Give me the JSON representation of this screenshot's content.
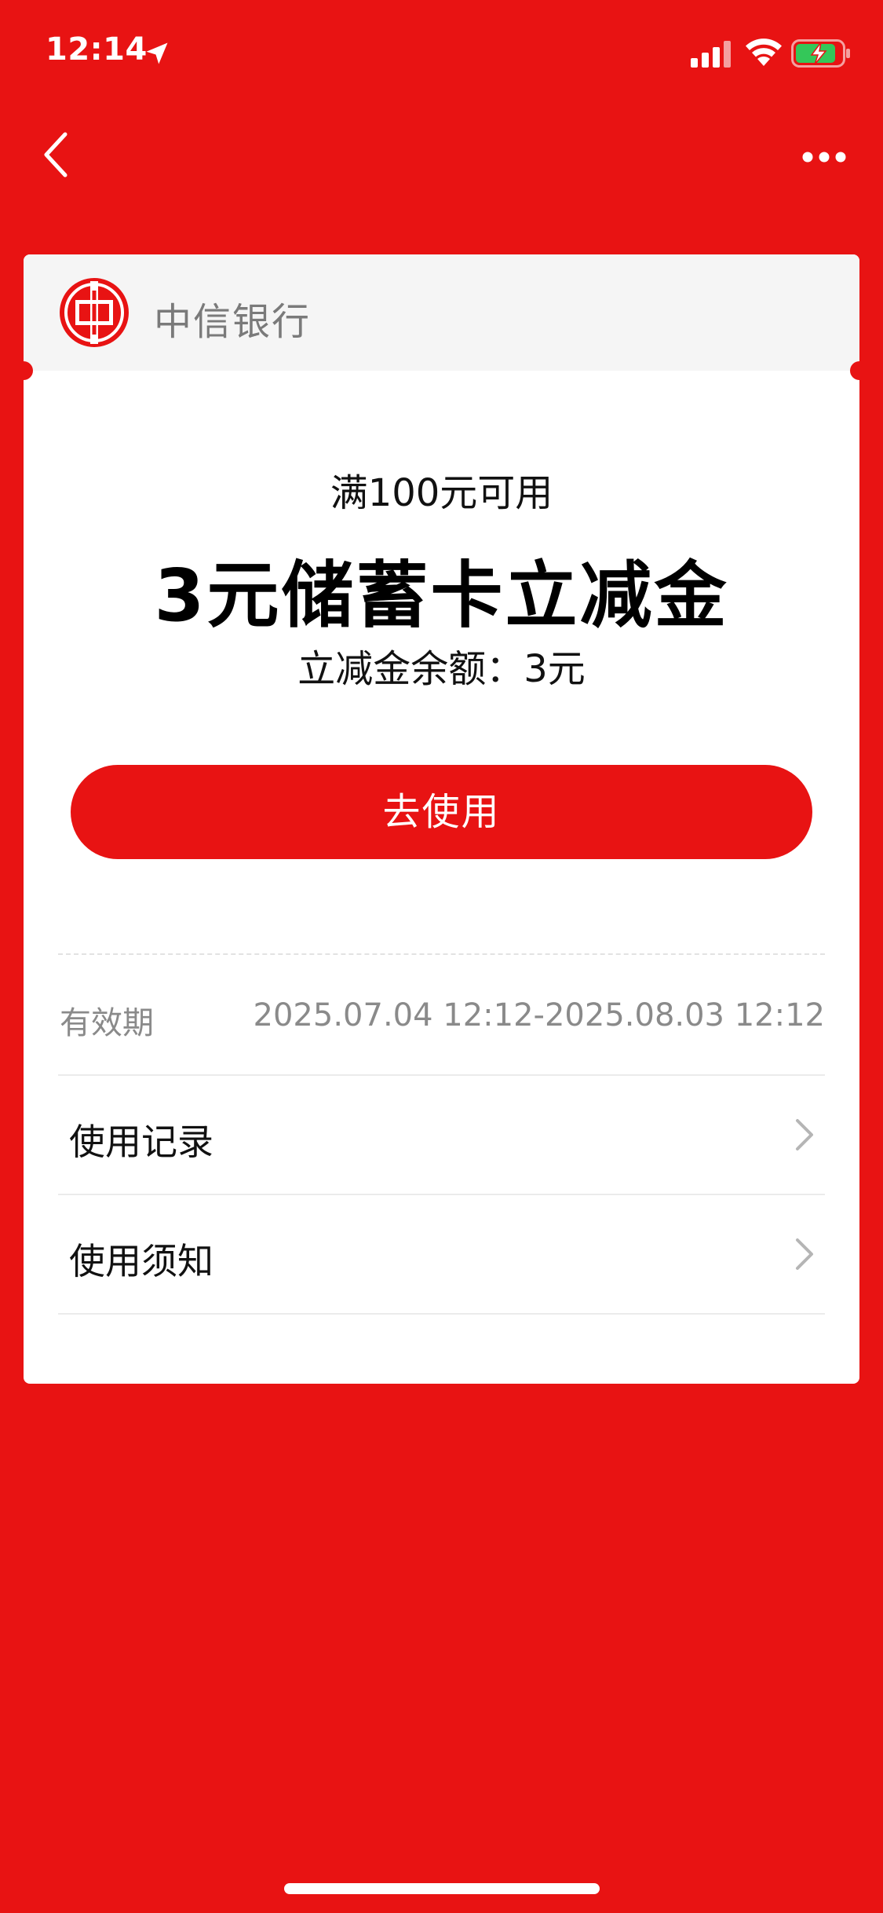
{
  "status_bar": {
    "time": "12:14"
  },
  "nav": {
    "back_icon": "chevron-left-icon",
    "more_icon": "more-horizontal-icon"
  },
  "card": {
    "bank_name": "中信银行",
    "condition": "满100元可用",
    "title": "3元储蓄卡立减金",
    "balance": "立减金余额：3元",
    "use_button_label": "去使用",
    "validity_label": "有效期",
    "validity_value": "2025.07.04 12:12-2025.08.03 12:12",
    "rows": [
      {
        "label": "使用记录"
      },
      {
        "label": "使用须知"
      }
    ]
  },
  "colors": {
    "brand_red": "#E81313",
    "muted_text": "#8A8A8A"
  }
}
